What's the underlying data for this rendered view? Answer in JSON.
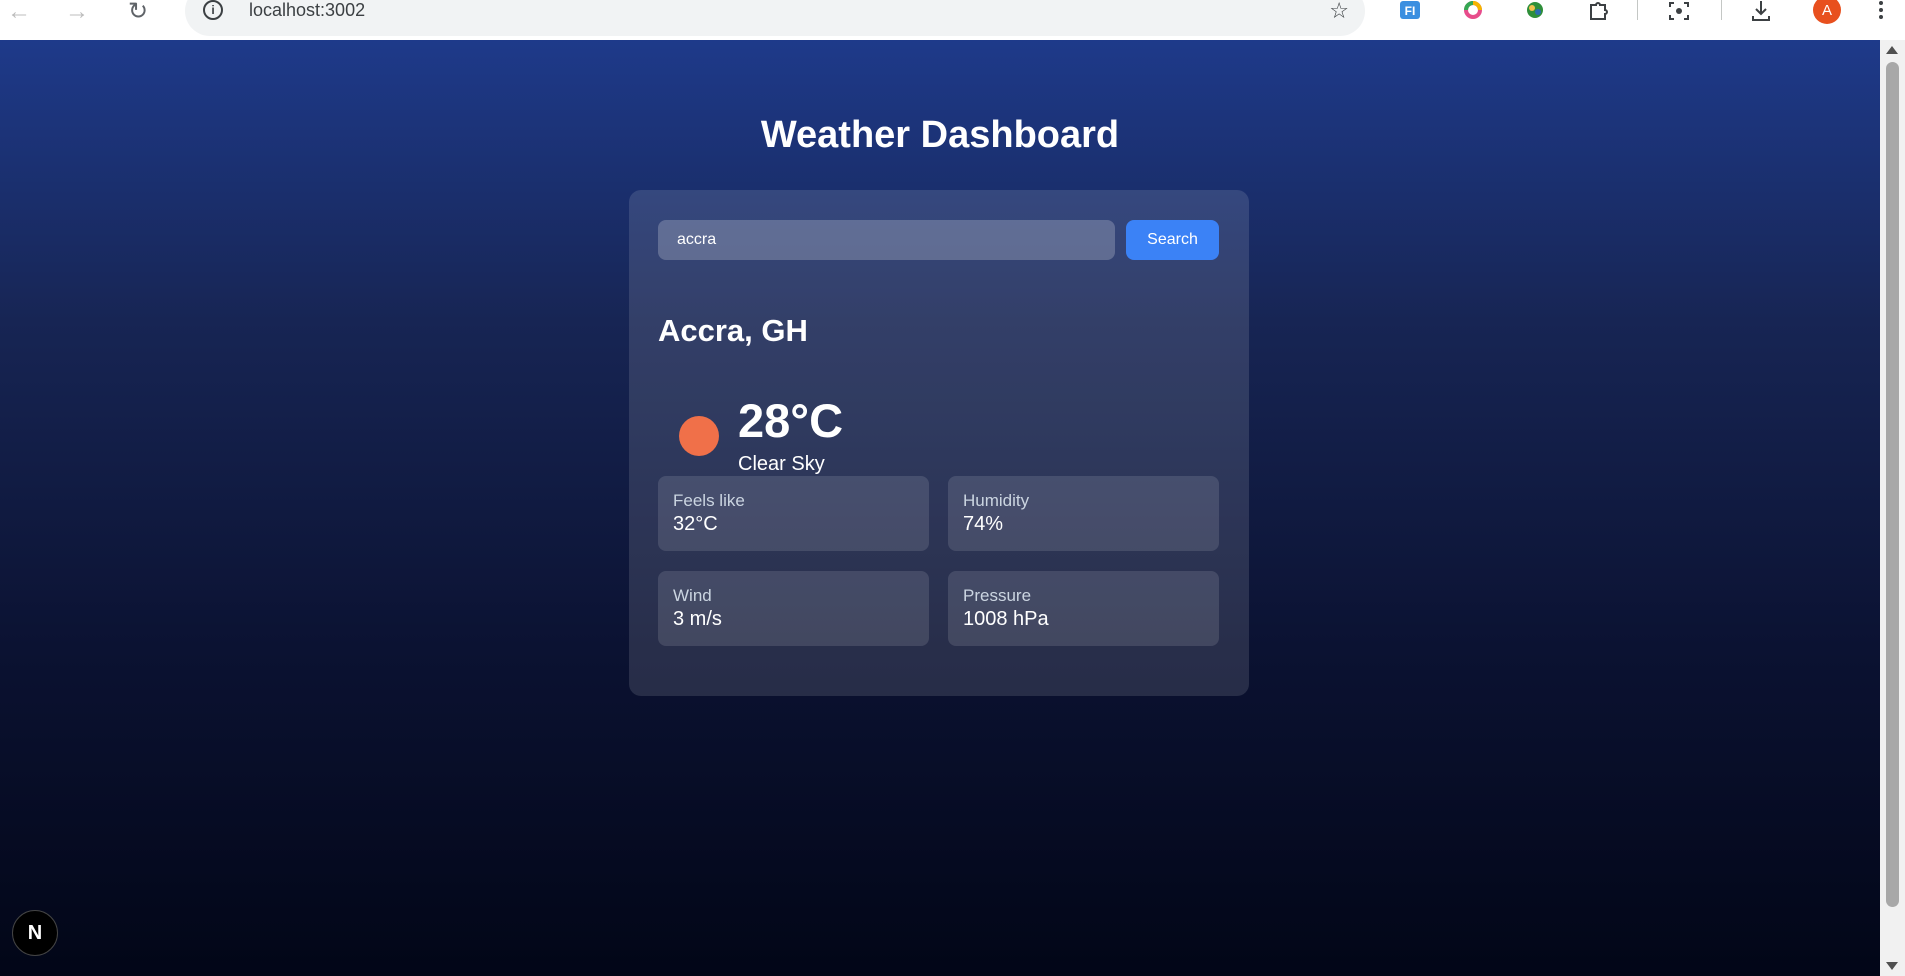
{
  "browser": {
    "url": "localhost:3002",
    "avatar_initial": "A",
    "extensions": [
      "fi-extension-icon",
      "ring-extension-icon",
      "earth-extension-icon",
      "puzzle-icon",
      "screenshot-icon",
      "download-icon"
    ]
  },
  "page": {
    "title": "Weather Dashboard"
  },
  "search": {
    "value": "accra",
    "button_label": "Search"
  },
  "weather": {
    "location": "Accra, GH",
    "temperature": "28°C",
    "condition": "Clear Sky",
    "icon_color": "#f07049"
  },
  "stats": [
    {
      "label": "Feels like",
      "value": "32°C"
    },
    {
      "label": "Humidity",
      "value": "74%"
    },
    {
      "label": "Wind",
      "value": "3 m/s"
    },
    {
      "label": "Pressure",
      "value": "1008 hPa"
    }
  ],
  "badge": {
    "letter": "N"
  },
  "colors": {
    "accent": "#3b82f6",
    "bg_top": "#1e3a8a",
    "bg_bottom": "#020617"
  }
}
